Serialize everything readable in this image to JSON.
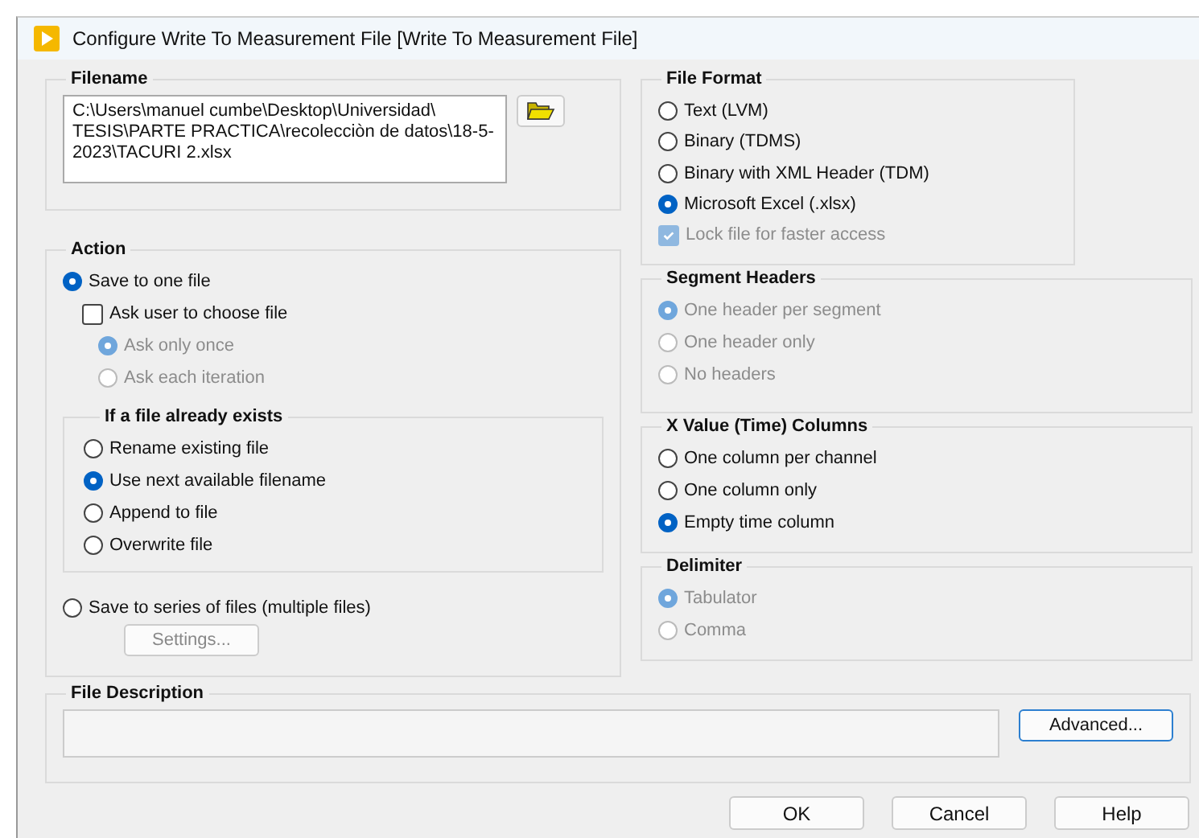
{
  "window": {
    "title": "Configure Write To Measurement File [Write To Measurement File]"
  },
  "filename": {
    "title": "Filename",
    "value": "C:\\Users\\manuel cumbe\\Desktop\\Universidad\\ TESIS\\PARTE PRACTICA\\recolecciòn de datos\\18-5-2023\\TACURI 2.xlsx"
  },
  "action": {
    "title": "Action",
    "save_one": {
      "label": "Save to one file",
      "selected": true,
      "disabled": false
    },
    "ask_user": {
      "label": "Ask user to choose file",
      "checked": false,
      "disabled": false
    },
    "ask_options": [
      {
        "label": "Ask only once",
        "selected": true,
        "disabled": true
      },
      {
        "label": "Ask each iteration",
        "selected": false,
        "disabled": true
      }
    ],
    "if_exists": {
      "title": "If a file already exists",
      "options": [
        {
          "label": "Rename existing file",
          "selected": false,
          "disabled": false
        },
        {
          "label": "Use next available filename",
          "selected": true,
          "disabled": false
        },
        {
          "label": "Append to file",
          "selected": false,
          "disabled": false
        },
        {
          "label": "Overwrite file",
          "selected": false,
          "disabled": false
        }
      ]
    },
    "save_series": {
      "label": "Save to series of files (multiple files)",
      "selected": false,
      "disabled": false
    },
    "settings_button": {
      "label": "Settings...",
      "disabled": true
    }
  },
  "file_format": {
    "title": "File Format",
    "options": [
      {
        "label": "Text (LVM)",
        "selected": false,
        "disabled": false
      },
      {
        "label": "Binary (TDMS)",
        "selected": false,
        "disabled": false
      },
      {
        "label": "Binary with XML Header (TDM)",
        "selected": false,
        "disabled": false
      },
      {
        "label": "Microsoft Excel (.xlsx)",
        "selected": true,
        "disabled": false
      }
    ],
    "lock": {
      "label": "Lock file for faster access",
      "checked": true,
      "disabled": true
    }
  },
  "right_groups": [
    {
      "title": "Segment Headers",
      "options": [
        {
          "label": "One header per segment",
          "selected": true,
          "disabled": true
        },
        {
          "label": "One header only",
          "selected": false,
          "disabled": true
        },
        {
          "label": "No headers",
          "selected": false,
          "disabled": true
        }
      ]
    },
    {
      "title": "X Value (Time) Columns",
      "options": [
        {
          "label": "One column per channel",
          "selected": false,
          "disabled": false
        },
        {
          "label": "One column only",
          "selected": false,
          "disabled": false
        },
        {
          "label": "Empty time column",
          "selected": true,
          "disabled": false
        }
      ]
    },
    {
      "title": "Delimiter",
      "options": [
        {
          "label": "Tabulator",
          "selected": true,
          "disabled": true
        },
        {
          "label": "Comma",
          "selected": false,
          "disabled": true
        }
      ]
    }
  ],
  "file_description": {
    "title": "File Description",
    "advanced_button": "Advanced..."
  },
  "buttons": [
    "OK",
    "Cancel",
    "Help"
  ]
}
